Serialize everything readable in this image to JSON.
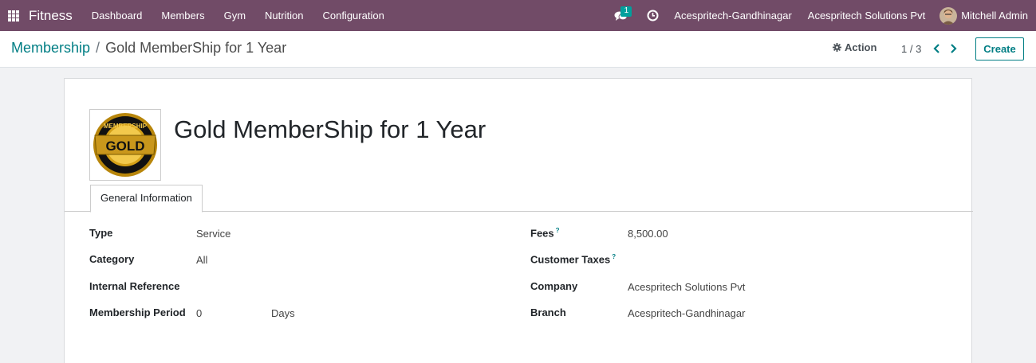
{
  "navbar": {
    "app_name": "Fitness",
    "menu": [
      "Dashboard",
      "Members",
      "Gym",
      "Nutrition",
      "Configuration"
    ],
    "chat_badge": "1",
    "branch": "Acespritech-Gandhinagar",
    "company": "Acespritech Solutions Pvt",
    "user": "Mitchell Admin",
    "colors": {
      "bar": "#714b67",
      "accent": "#017e84"
    }
  },
  "breadcrumb": {
    "parent": "Membership",
    "separator": "/",
    "current": "Gold MemberShip for 1 Year"
  },
  "toolbar": {
    "action_label": "Action",
    "pager": "1 / 3",
    "create_label": "Create"
  },
  "record": {
    "image_text": "GOLD",
    "image_ring_text": "MEMBERSHIP",
    "title": "Gold MemberShip for 1 Year",
    "tab": "General Information",
    "left_fields": {
      "type": {
        "label": "Type",
        "value": "Service"
      },
      "category": {
        "label": "Category",
        "value": "All"
      },
      "internal_reference": {
        "label": "Internal Reference",
        "value": ""
      },
      "membership_period": {
        "label": "Membership Period",
        "value": "0",
        "unit": "Days"
      }
    },
    "right_fields": {
      "fees": {
        "label": "Fees",
        "help": "?",
        "value": "8,500.00"
      },
      "customer_taxes": {
        "label": "Customer Taxes",
        "help": "?",
        "value": ""
      },
      "company": {
        "label": "Company",
        "value": "Acespritech Solutions Pvt"
      },
      "branch": {
        "label": "Branch",
        "value": "Acespritech-Gandhinagar"
      }
    }
  }
}
